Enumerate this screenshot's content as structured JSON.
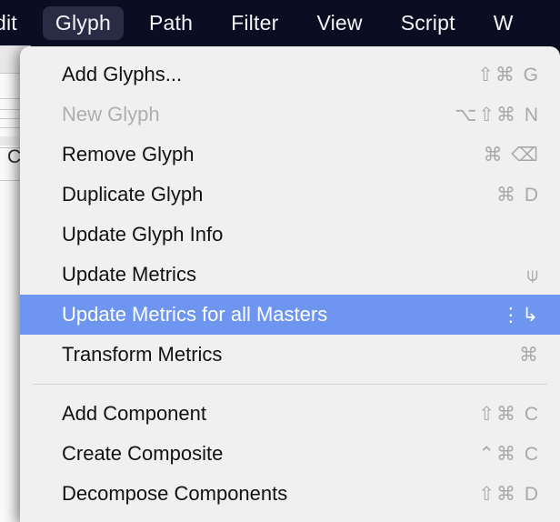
{
  "menubar": {
    "items": [
      {
        "label": "dit",
        "active": false,
        "clipped": true,
        "name": "menubar-item-edit"
      },
      {
        "label": "Glyph",
        "active": true,
        "clipped": false,
        "name": "menubar-item-glyph"
      },
      {
        "label": "Path",
        "active": false,
        "clipped": false,
        "name": "menubar-item-path"
      },
      {
        "label": "Filter",
        "active": false,
        "clipped": false,
        "name": "menubar-item-filter"
      },
      {
        "label": "View",
        "active": false,
        "clipped": false,
        "name": "menubar-item-view"
      },
      {
        "label": "Script",
        "active": false,
        "clipped": false,
        "name": "menubar-item-script"
      },
      {
        "label": "W",
        "active": false,
        "clipped": false,
        "name": "menubar-item-window"
      }
    ]
  },
  "background_window": {
    "letter": "C"
  },
  "menu": {
    "title": "Glyph",
    "highlight_color": "#6e96f0",
    "panel_color": "#f0f0f0",
    "groups": [
      {
        "items": [
          {
            "label": "Add Glyphs...",
            "shortcut": "⇧⌘ G",
            "disabled": false,
            "selected": false,
            "name": "menu-item-add-glyphs"
          },
          {
            "label": "New Glyph",
            "shortcut": "⌥⇧⌘ N",
            "disabled": true,
            "selected": false,
            "name": "menu-item-new-glyph"
          },
          {
            "label": "Remove Glyph",
            "shortcut": "⌘ ⌫",
            "disabled": false,
            "selected": false,
            "name": "menu-item-remove-glyph"
          },
          {
            "label": "Duplicate Glyph",
            "shortcut": "⌘ D",
            "disabled": false,
            "selected": false,
            "name": "menu-item-duplicate-glyph"
          },
          {
            "label": "Update Glyph Info",
            "shortcut": "",
            "disabled": false,
            "selected": false,
            "name": "menu-item-update-glyph-info"
          },
          {
            "label": "Update Metrics",
            "shortcut": "⍦",
            "disabled": false,
            "selected": false,
            "name": "menu-item-update-metrics"
          },
          {
            "label": "Update Metrics for all Masters",
            "shortcut": "⋮↳",
            "disabled": false,
            "selected": true,
            "name": "menu-item-update-metrics-all-masters"
          },
          {
            "label": "Transform Metrics",
            "shortcut": "⌘",
            "disabled": false,
            "selected": false,
            "name": "menu-item-transform-metrics"
          }
        ]
      },
      {
        "items": [
          {
            "label": "Add Component",
            "shortcut": "⇧⌘ C",
            "disabled": false,
            "selected": false,
            "name": "menu-item-add-component"
          },
          {
            "label": "Create Composite",
            "shortcut": "⌃⌘ C",
            "disabled": false,
            "selected": false,
            "name": "menu-item-create-composite"
          },
          {
            "label": "Decompose Components",
            "shortcut": "⇧⌘ D",
            "disabled": false,
            "selected": false,
            "name": "menu-item-decompose-components"
          }
        ]
      }
    ]
  }
}
